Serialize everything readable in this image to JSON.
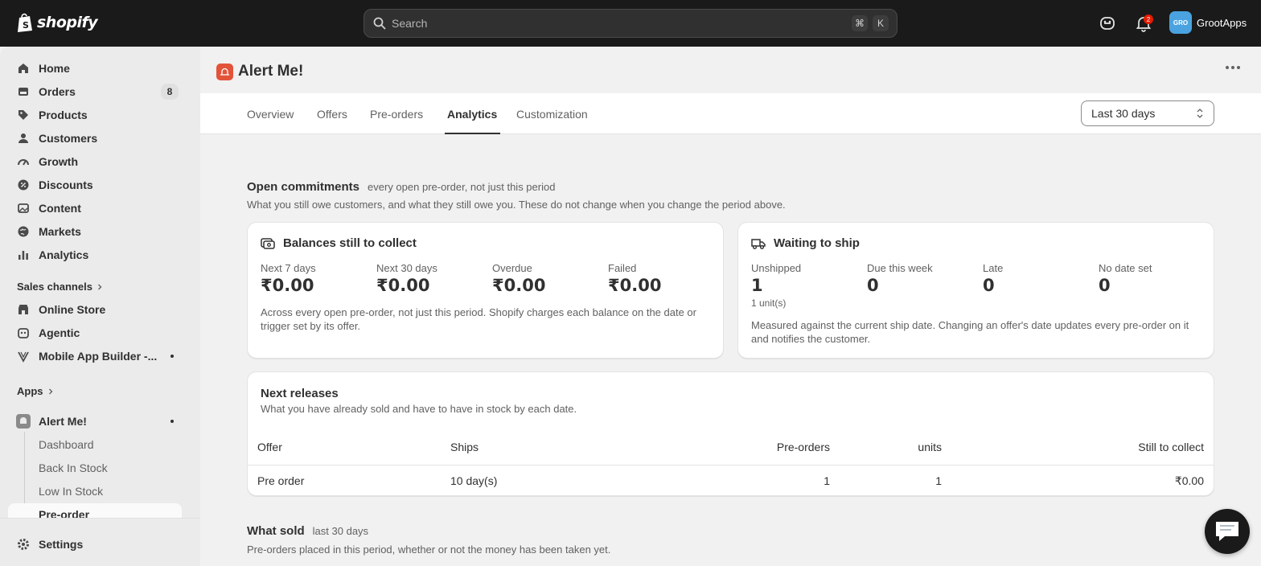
{
  "topbar": {
    "brand": "shopify",
    "search_placeholder": "Search",
    "shortcut_keys": [
      "⌘",
      "K"
    ],
    "notification_count": "2",
    "account_initials": "GRO",
    "account_name": "GrootApps"
  },
  "sidebar": {
    "items": [
      {
        "label": "Home",
        "icon": "home-icon"
      },
      {
        "label": "Orders",
        "icon": "orders-icon",
        "count": "8"
      },
      {
        "label": "Products",
        "icon": "tag-icon"
      },
      {
        "label": "Customers",
        "icon": "person-icon"
      },
      {
        "label": "Growth",
        "icon": "gauge-icon"
      },
      {
        "label": "Discounts",
        "icon": "discount-icon"
      },
      {
        "label": "Content",
        "icon": "image-icon"
      },
      {
        "label": "Markets",
        "icon": "globe-icon"
      },
      {
        "label": "Analytics",
        "icon": "bar-chart-icon"
      }
    ],
    "sales_channels_label": "Sales channels",
    "channels": [
      {
        "label": "Online Store",
        "icon": "store-icon"
      },
      {
        "label": "Agentic",
        "icon": "agent-icon"
      },
      {
        "label": "Mobile App Builder -...",
        "icon": "app-builder-icon"
      }
    ],
    "apps_label": "Apps",
    "app_name": "Alert Me!",
    "app_subitems": [
      "Dashboard",
      "Back In Stock",
      "Low In Stock",
      "Pre-order"
    ],
    "settings_label": "Settings"
  },
  "page": {
    "title": "Alert Me!",
    "tabs": [
      "Overview",
      "Offers",
      "Pre-orders",
      "Analytics",
      "Customization"
    ],
    "active_tab": "Analytics",
    "period": "Last 30 days"
  },
  "open_commitments": {
    "title": "Open commitments",
    "subtitle": "every open pre-order, not just this period",
    "description": "What you still owe customers, and what they still owe you. These do not change when you change the period above."
  },
  "balances_card": {
    "title": "Balances still to collect",
    "stats": [
      {
        "label": "Next 7 days",
        "value": "₹0.00"
      },
      {
        "label": "Next 30 days",
        "value": "₹0.00"
      },
      {
        "label": "Overdue",
        "value": "₹0.00"
      },
      {
        "label": "Failed",
        "value": "₹0.00"
      }
    ],
    "note": "Across every open pre-order, not just this period. Shopify charges each balance on the date or trigger set by its offer."
  },
  "shipping_card": {
    "title": "Waiting to ship",
    "stats": [
      {
        "label": "Unshipped",
        "value": "1",
        "note": "1 unit(s)"
      },
      {
        "label": "Due this week",
        "value": "0"
      },
      {
        "label": "Late",
        "value": "0"
      },
      {
        "label": "No date set",
        "value": "0"
      }
    ],
    "note": "Measured against the current ship date. Changing an offer's date updates every pre-order on it and notifies the customer."
  },
  "next_releases": {
    "title": "Next releases",
    "description": "What you have already sold and have to have in stock by each date.",
    "columns": [
      "Offer",
      "Ships",
      "Pre-orders",
      "units",
      "Still to collect"
    ],
    "rows": [
      {
        "offer": "Pre order",
        "ships": "10 day(s)",
        "preorders": "1",
        "units": "1",
        "still_to_collect": "₹0.00"
      }
    ]
  },
  "what_sold": {
    "title": "What sold",
    "subtitle": "last 30 days",
    "description": "Pre-orders placed in this period, whether or not the money has been taken yet."
  }
}
